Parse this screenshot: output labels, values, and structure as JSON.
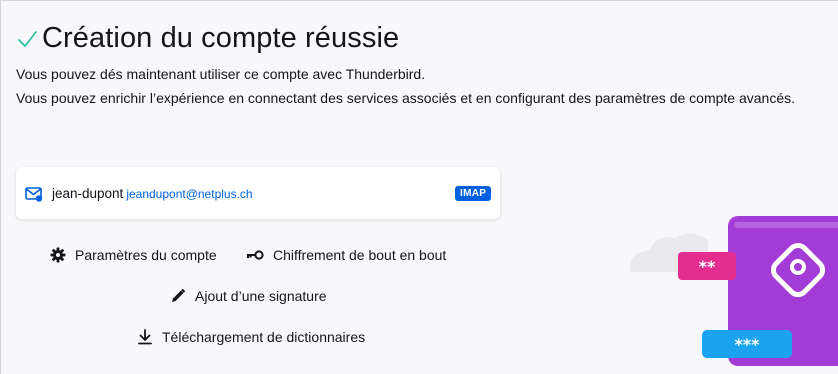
{
  "header": {
    "check_icon": "check-icon",
    "title": "Création du compte réussie",
    "line1": "Vous pouvez dés maintenant utiliser ce compte avec Thunderbird.",
    "line2": "Vous pouvez enrichir l’expérience en connectant des services associés et en configurant des paramètres de compte avancés."
  },
  "account": {
    "icon": "mail-account-icon",
    "name": "jean-dupont",
    "email": "jeandupont@netplus.ch",
    "protocol": "IMAP"
  },
  "actions": {
    "settings": {
      "label": "Paramètres du compte",
      "icon": "gear-icon"
    },
    "e2e": {
      "label": "Chiffrement de bout en bout",
      "icon": "key-icon"
    },
    "signature": {
      "label": "Ajout d’une signature",
      "icon": "pen-icon"
    },
    "dictionaries": {
      "label": "Téléchargement de dictionnaires",
      "icon": "download-icon"
    }
  },
  "illustration": {
    "password_short": "**",
    "password_long": "***"
  },
  "colors": {
    "accent": "#0061e0",
    "success": "#2ac3a2",
    "pink": "#e42e8f",
    "purple": "#a33cd6",
    "sky": "#1ba3f0"
  }
}
